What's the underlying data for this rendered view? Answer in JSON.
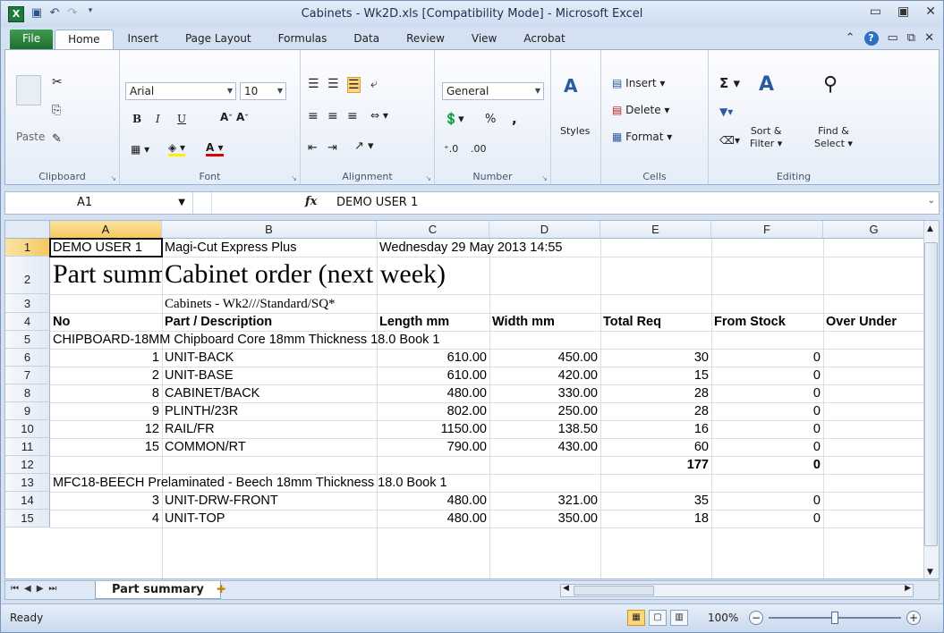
{
  "window": {
    "title": "Cabinets - Wk2D.xls  [Compatibility Mode]  -  Microsoft Excel"
  },
  "ribbon_tabs": [
    "File",
    "Home",
    "Insert",
    "Page Layout",
    "Formulas",
    "Data",
    "Review",
    "View",
    "Acrobat"
  ],
  "ribbon": {
    "clipboard": {
      "paste": "Paste",
      "label": "Clipboard"
    },
    "font": {
      "name": "Arial",
      "size": "10",
      "label": "Font",
      "bold": "B",
      "italic": "I",
      "underline": "U"
    },
    "alignment": {
      "label": "Alignment"
    },
    "number": {
      "format": "General",
      "percent": "%",
      "comma": ",",
      "label": "Number",
      "inc": ".0 .00",
      "dec": ".00 .0"
    },
    "styles": {
      "label": "Styles"
    },
    "cells": {
      "insert": "Insert",
      "delete": "Delete",
      "format": "Format",
      "label": "Cells"
    },
    "editing": {
      "sigma": "Σ",
      "sort": "Sort &",
      "filter": "Filter",
      "find": "Find &",
      "select": "Select",
      "label": "Editing"
    }
  },
  "formula_bar": {
    "name_box": "A1",
    "fx": "fx",
    "value": "DEMO USER 1"
  },
  "columns": [
    "A",
    "B",
    "C",
    "D",
    "E",
    "F",
    "G"
  ],
  "rows": [
    "1",
    "2",
    "3",
    "4",
    "5",
    "6",
    "7",
    "8",
    "9",
    "10",
    "11",
    "12",
    "13",
    "14",
    "15"
  ],
  "cells": {
    "r1": {
      "A": "DEMO USER 1",
      "B": "Magi-Cut Express Plus",
      "C": "Wednesday 29 May 2013 14:55"
    },
    "r2": {
      "A": "Part summary",
      "B": "Cabinet order (next week)"
    },
    "r3": {
      "B": "Cabinets - Wk2///Standard/SQ*"
    },
    "r4": {
      "A": "No",
      "B": "Part / Description",
      "C": "Length mm",
      "D": "Width mm",
      "E": "Total Req",
      "F": "From Stock",
      "G": "Over Under"
    },
    "r5": {
      "A": "CHIPBOARD-18MM Chipboard Core 18mm Thickness  18.0 Book 1"
    },
    "r6": {
      "A": "1",
      "B": "UNIT-BACK",
      "C": "610.00",
      "D": "450.00",
      "E": "30",
      "F": "0"
    },
    "r7": {
      "A": "2",
      "B": "UNIT-BASE",
      "C": "610.00",
      "D": "420.00",
      "E": "15",
      "F": "0"
    },
    "r8": {
      "A": "8",
      "B": "CABINET/BACK",
      "C": "480.00",
      "D": "330.00",
      "E": "28",
      "F": "0"
    },
    "r9": {
      "A": "9",
      "B": "PLINTH/23R",
      "C": "802.00",
      "D": "250.00",
      "E": "28",
      "F": "0"
    },
    "r10": {
      "A": "12",
      "B": "RAIL/FR",
      "C": "1150.00",
      "D": "138.50",
      "E": "16",
      "F": "0"
    },
    "r11": {
      "A": "15",
      "B": "COMMON/RT",
      "C": "790.00",
      "D": "430.00",
      "E": "60",
      "F": "0"
    },
    "r12": {
      "E": "177",
      "F": "0"
    },
    "r13": {
      "A": "MFC18-BEECH Prelaminated - Beech 18mm Thickness  18.0 Book 1"
    },
    "r14": {
      "A": "3",
      "B": "UNIT-DRW-FRONT",
      "C": "480.00",
      "D": "321.00",
      "E": "35",
      "F": "0"
    },
    "r15": {
      "A": "4",
      "B": "UNIT-TOP",
      "C": "480.00",
      "D": "350.00",
      "E": "18",
      "F": "0"
    }
  },
  "sheet_tabs": {
    "active": "Part summary"
  },
  "status": {
    "ready": "Ready",
    "zoom": "100%",
    "zoom_level_percent": 100
  }
}
